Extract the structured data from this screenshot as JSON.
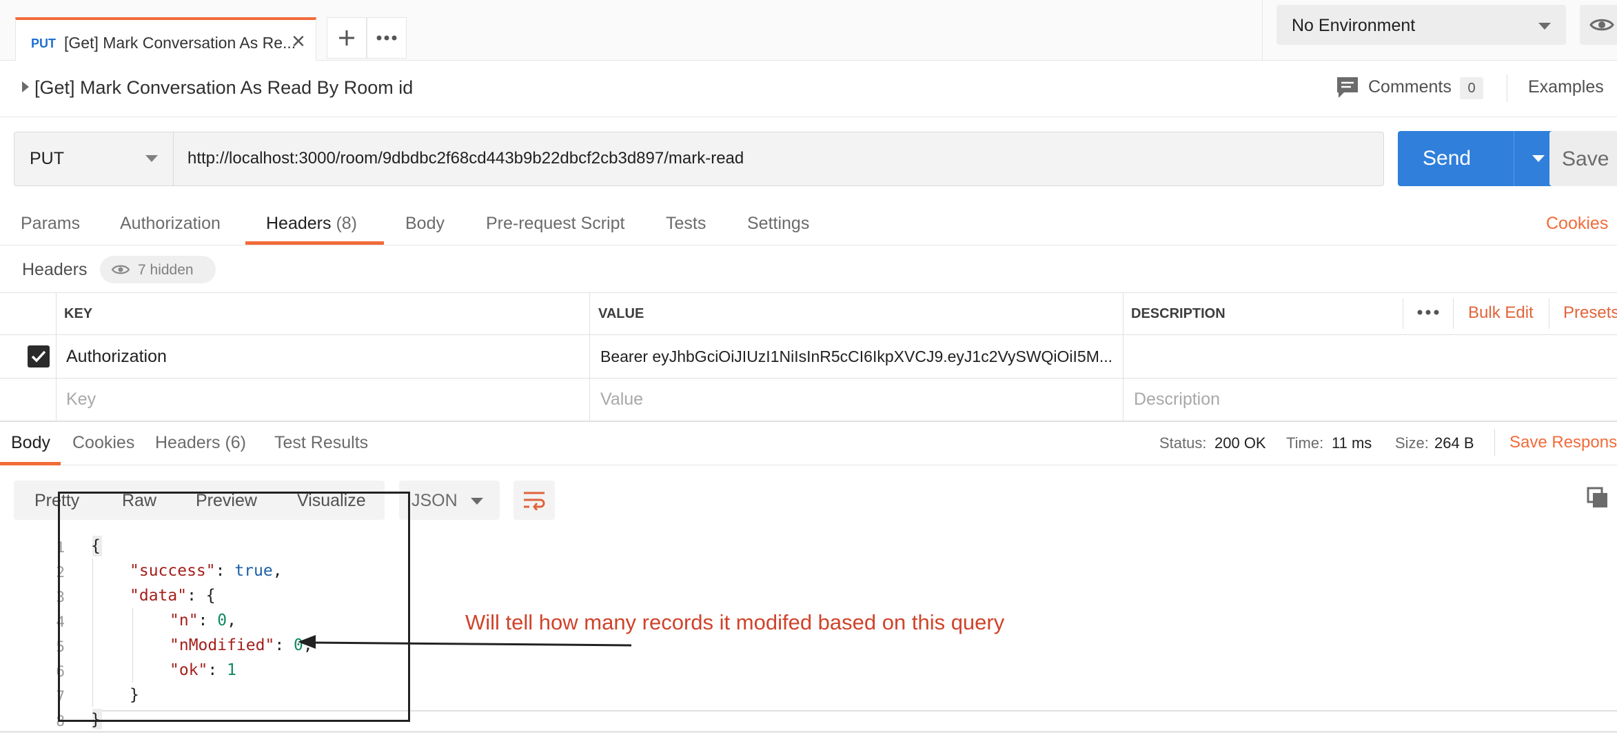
{
  "tab": {
    "method": "PUT",
    "title": "[Get] Mark Conversation As Re...",
    "close": "×"
  },
  "environment": {
    "selected": "No Environment"
  },
  "breadcrumb": {
    "title": "[Get] Mark Conversation As Read By Room id",
    "comments_label": "Comments",
    "comments_count": "0",
    "examples_label": "Examples"
  },
  "request": {
    "method": "PUT",
    "url": "http://localhost:3000/room/9dbdbc2f68cd443b9b22dbcf2cb3d897/mark-read",
    "send_label": "Send",
    "save_label": "Save"
  },
  "request_tabs": [
    {
      "label": "Params"
    },
    {
      "label": "Authorization"
    },
    {
      "label": "Headers",
      "count": "(8)"
    },
    {
      "label": "Body"
    },
    {
      "label": "Pre-request Script"
    },
    {
      "label": "Tests"
    },
    {
      "label": "Settings"
    }
  ],
  "cookies_link": "Cookies",
  "headers_section": {
    "title": "Headers",
    "hidden_label": "7 hidden",
    "columns": {
      "key": "KEY",
      "value": "VALUE",
      "description": "DESCRIPTION"
    },
    "bulk_edit": "Bulk Edit",
    "presets": "Presets",
    "rows": [
      {
        "key": "Authorization",
        "value": "Bearer eyJhbGciOiJIUzI1NiIsInR5cCI6IkpXVCJ9.eyJ1c2VySWQiOiI5M...",
        "description": ""
      }
    ],
    "placeholders": {
      "key": "Key",
      "value": "Value",
      "description": "Description"
    }
  },
  "response": {
    "tabs": [
      {
        "label": "Body"
      },
      {
        "label": "Cookies"
      },
      {
        "label": "Headers (6)"
      },
      {
        "label": "Test Results"
      }
    ],
    "status_label": "Status:",
    "status_value": "200 OK",
    "time_label": "Time:",
    "time_value": "11 ms",
    "size_label": "Size:",
    "size_value": "264 B",
    "save_response": "Save Respons",
    "view_tabs": [
      {
        "label": "Pretty"
      },
      {
        "label": "Raw"
      },
      {
        "label": "Preview"
      },
      {
        "label": "Visualize"
      }
    ],
    "format": "JSON",
    "line_numbers": [
      "1",
      "2",
      "3",
      "4",
      "5",
      "6",
      "7",
      "8"
    ],
    "code": {
      "l1": "{",
      "success_key": "\"success\"",
      "success_val": "true",
      "data_key": "\"data\"",
      "n_key": "\"n\"",
      "n_val": "0",
      "nmod_key": "\"nModified\"",
      "nmod_val": "0",
      "ok_key": "\"ok\"",
      "ok_val": "1",
      "l7": "}",
      "l8": "}"
    }
  },
  "annotation": {
    "text": "Will tell how many records it modifed based on this query"
  },
  "colors": {
    "accent": "#f26b3a",
    "send": "#2f7fdb",
    "json_key": "#a3201c",
    "json_bool": "#1c5fa8",
    "annotation": "#d0432b"
  },
  "icons": [
    "plus-icon",
    "more-icon",
    "eye-icon",
    "chevron-down-icon",
    "caret-right-icon",
    "comments-icon",
    "checkbox-icon",
    "wrap-icon",
    "copy-icon",
    "close-icon"
  ]
}
